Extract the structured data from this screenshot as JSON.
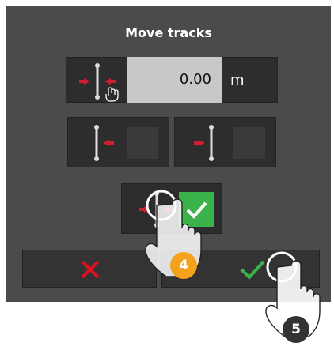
{
  "dialog": {
    "title": "Move tracks",
    "offset_value": "0.00",
    "unit": "m"
  },
  "icons": {
    "move_both": "track-move-center-hand-icon",
    "move_left": "track-move-left-icon",
    "move_right": "track-move-right-icon",
    "move_both_checked": "track-move-both-icon",
    "checkbox_checked": "checkmark-icon",
    "cancel": "x-icon",
    "confirm": "checkmark-icon"
  },
  "colors": {
    "panel_bg": "#4b4b4b",
    "tile_bg": "#2d2d2d",
    "field_bg": "#c8c8c8",
    "arrow_red": "#cc1f2f",
    "check_green": "#3bb34a",
    "cancel_red": "#e0101e",
    "badge_orange": "#f4a21c",
    "badge_dark": "#333333"
  },
  "annotations": {
    "step_4": "4",
    "step_5": "5"
  }
}
